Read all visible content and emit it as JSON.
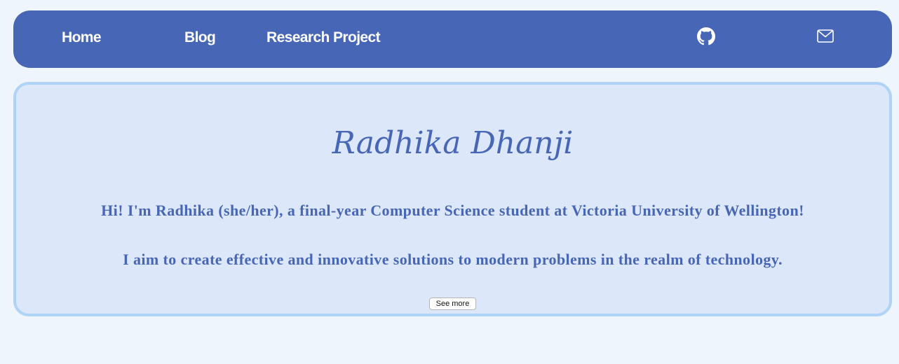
{
  "nav": {
    "links": [
      {
        "label": "Home"
      },
      {
        "label": "Blog"
      },
      {
        "label": "Research Project"
      }
    ],
    "icons": [
      "github-icon",
      "mail-icon"
    ],
    "colors": {
      "background": "#4766b6",
      "text": "#ffffff"
    }
  },
  "hero": {
    "title": "Radhika Dhanji",
    "intro": "Hi! I'm Radhika (she/her), a final-year Computer Science student at Victoria University of Wellington!",
    "aim": "I aim to create effective and innovative solutions to modern problems in the realm of technology.",
    "see_more_label": "See more",
    "colors": {
      "background": "#dce8f9",
      "border": "#aed3f7",
      "text": "#4766b6"
    }
  },
  "page": {
    "colors": {
      "background": "#eef5fd"
    }
  }
}
